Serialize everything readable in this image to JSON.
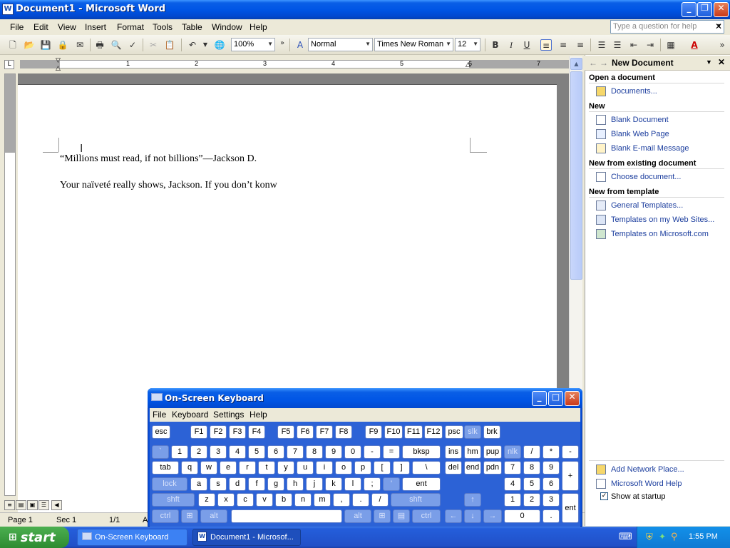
{
  "window": {
    "title": "Document1 - Microsoft Word",
    "app_icon": "W"
  },
  "menu": [
    "File",
    "Edit",
    "View",
    "Insert",
    "Format",
    "Tools",
    "Table",
    "Window",
    "Help"
  ],
  "help_box": {
    "placeholder": "Type a question for help"
  },
  "toolbar": {
    "zoom": "100%",
    "style": "Normal",
    "font": "Times New Roman",
    "size": "12",
    "bold": "B",
    "italic": "I",
    "underline": "U"
  },
  "ruler": {
    "numbers": [
      "1",
      "2",
      "3",
      "4",
      "5",
      "6",
      "7"
    ]
  },
  "document": {
    "line1": "“Millions must read, if not billions”—Jackson D.",
    "line2": "Your naïveté really shows, Jackson. If you don’t konw"
  },
  "status": {
    "page": "Page 1",
    "sec": "Sec 1",
    "pages": "1/1",
    "at": "A"
  },
  "task_pane": {
    "title": "New Document",
    "sections": {
      "open": "Open a document",
      "new": "New",
      "existing": "New from existing document",
      "template": "New from template"
    },
    "links": {
      "documents": "Documents...",
      "blank_document": "Blank Document",
      "blank_web": "Blank Web Page",
      "blank_email": "Blank E-mail Message",
      "choose": "Choose document...",
      "general_templates": "General Templates...",
      "templates_web": "Templates on my Web Sites...",
      "templates_ms": "Templates on Microsoft.com",
      "add_network": "Add Network Place...",
      "word_help": "Microsoft Word Help",
      "show_startup": "Show at startup"
    }
  },
  "osk": {
    "title": "On-Screen Keyboard",
    "menu": [
      "File",
      "Keyboard",
      "Settings",
      "Help"
    ],
    "row_f": [
      "esc",
      "F1",
      "F2",
      "F3",
      "F4",
      "F5",
      "F6",
      "F7",
      "F8",
      "F9",
      "F10",
      "F11",
      "F12",
      "psc",
      "slk",
      "brk"
    ],
    "row_num": [
      "`",
      "1",
      "2",
      "3",
      "4",
      "5",
      "6",
      "7",
      "8",
      "9",
      "0",
      "-",
      "=",
      "bksp",
      "ins",
      "hm",
      "pup",
      "nlk",
      "/",
      "*",
      "-"
    ],
    "row_tab": [
      "tab",
      "q",
      "w",
      "e",
      "r",
      "t",
      "y",
      "u",
      "i",
      "o",
      "p",
      "[",
      "]",
      "\\",
      "del",
      "end",
      "pdn",
      "7",
      "8",
      "9",
      "+"
    ],
    "row_caps": [
      "lock",
      "a",
      "s",
      "d",
      "f",
      "g",
      "h",
      "j",
      "k",
      "l",
      ";",
      "'",
      "ent",
      "4",
      "5",
      "6"
    ],
    "row_shift": [
      "shft",
      "z",
      "x",
      "c",
      "v",
      "b",
      "n",
      "m",
      ",",
      ".",
      "/",
      "shft",
      "↑",
      "1",
      "2",
      "3",
      "ent"
    ],
    "row_ctrl": [
      "ctrl",
      "alt",
      "alt",
      "ctrl",
      "←",
      "↓",
      "→",
      "0",
      "."
    ]
  },
  "taskbar": {
    "start": "start",
    "tasks": [
      "On-Screen Keyboard",
      "Document1 - Microsof..."
    ],
    "clock": "1:55 PM"
  }
}
